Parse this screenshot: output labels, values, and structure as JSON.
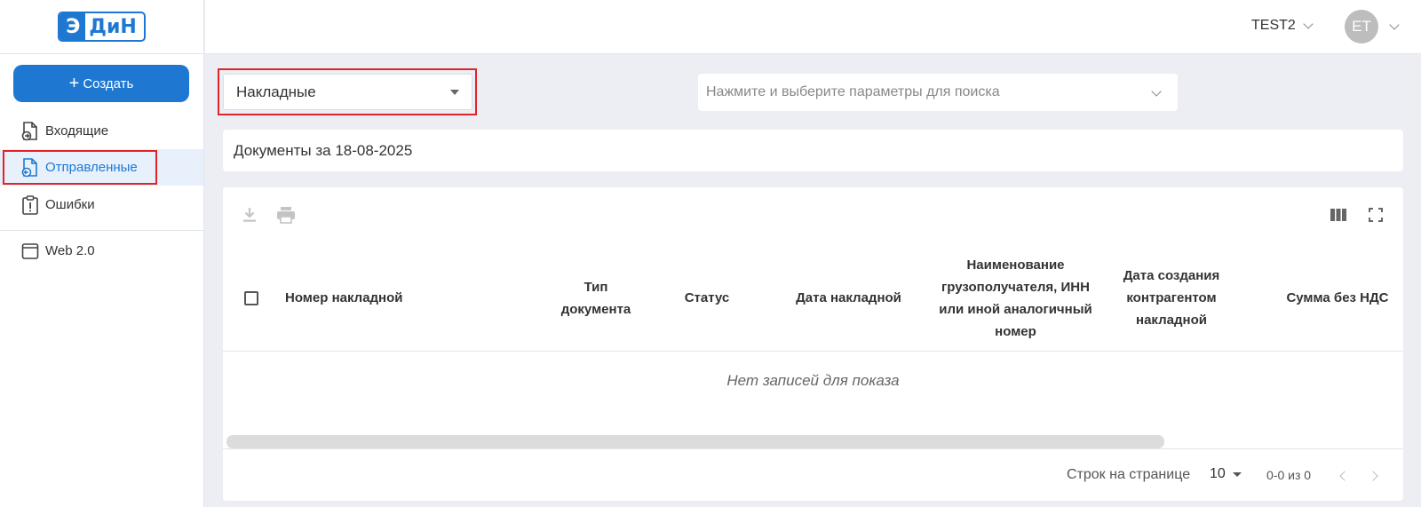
{
  "logo": {
    "part1": "Э",
    "part2": "ДиН"
  },
  "sidebar": {
    "create_label": "Создать",
    "items": [
      {
        "label": "Входящие"
      },
      {
        "label": "Отправленные"
      },
      {
        "label": "Ошибки"
      },
      {
        "label": "Web 2.0"
      }
    ]
  },
  "header": {
    "org": "TEST2",
    "avatar_initials": "ET"
  },
  "filters": {
    "doc_type": "Накладные",
    "search_placeholder": "Нажмите и выберите параметры для поиска"
  },
  "docs_title": "Документы за 18-08-2025",
  "table": {
    "columns": [
      "Номер накладной",
      "Тип документа",
      "Статус",
      "Дата накладной",
      "Наименование грузополучателя, ИНН или иной аналогичный номер",
      "Дата создания контрагентом накладной",
      "Сумма без НДС"
    ],
    "empty_text": "Нет записей для показа",
    "rows_label": "Строк на странице",
    "rows_per_page": "10",
    "range": "0-0 из 0"
  },
  "colors": {
    "accent": "#1e78d2",
    "highlight": "#e0242a"
  }
}
